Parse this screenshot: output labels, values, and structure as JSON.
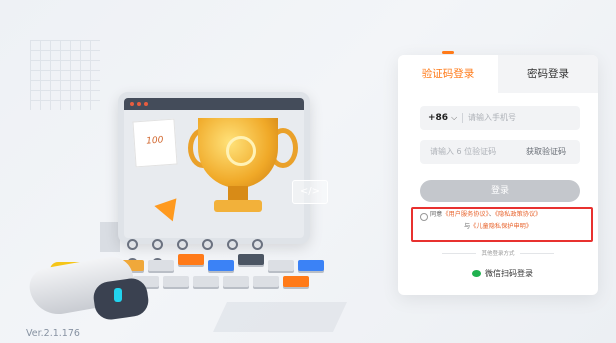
{
  "app": {
    "version": "Ver.2.1.176"
  },
  "illustration": {
    "paper_note": "100",
    "code_tag": "</>"
  },
  "login": {
    "tabs": [
      {
        "label": "验证码登录",
        "active": true
      },
      {
        "label": "密码登录",
        "active": false
      }
    ],
    "phone": {
      "country_code": "+86",
      "placeholder": "请输入手机号"
    },
    "code": {
      "placeholder": "请输入 6 位验证码",
      "get_code_label": "获取验证码"
    },
    "submit_label": "登录",
    "agreement": {
      "prefix": "同意",
      "link_terms": "《用户服务协议》",
      "separator": "、",
      "link_privacy": "《隐私政策协议》",
      "and": "与",
      "link_children": "《儿童隐私保护申明》"
    },
    "other_methods_label": "其他登录方式",
    "wechat_label": "微信扫码登录"
  },
  "colors": {
    "accent": "#ff7a18",
    "highlight_border": "#e8312f",
    "wechat_green": "#20b14f",
    "disabled_button": "#c4c7cc"
  }
}
